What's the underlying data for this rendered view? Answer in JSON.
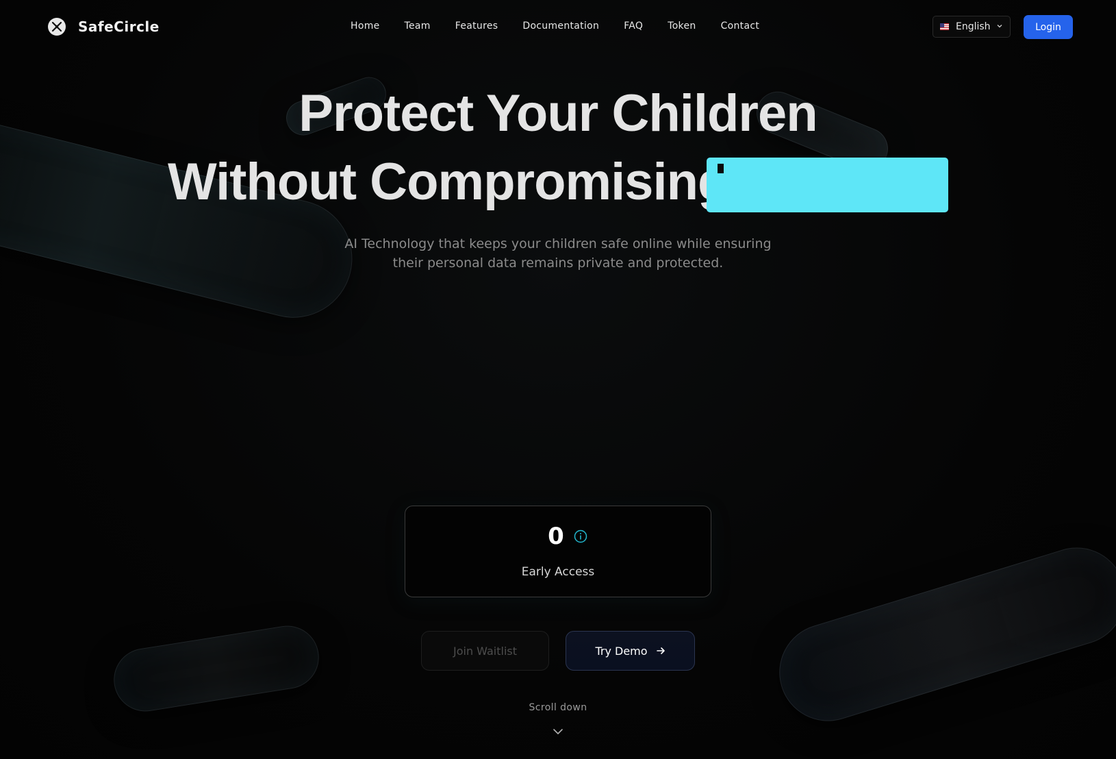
{
  "brand": {
    "name": "SafeCircle"
  },
  "nav": {
    "links": [
      "Home",
      "Team",
      "Features",
      "Documentation",
      "FAQ",
      "Token",
      "Contact"
    ]
  },
  "language": {
    "selected": "English",
    "flag": "us-flag-icon"
  },
  "login": {
    "label": "Login",
    "color": "#2563eb"
  },
  "hero": {
    "line1": "Protect Your Children",
    "line2": "Without Compromising",
    "typing_box_color": "#5ee6f7",
    "subtitle_line1": "AI Technology that keeps your children safe online while ensuring",
    "subtitle_line2": "their personal data remains private and protected."
  },
  "counter": {
    "value": "0",
    "label": "Early Access",
    "info_icon": "info-icon",
    "accent": "#22b8cf"
  },
  "actions": {
    "waitlist_label": "Join Waitlist",
    "demo_label": "Try Demo"
  },
  "scroll": {
    "label": "Scroll down"
  }
}
